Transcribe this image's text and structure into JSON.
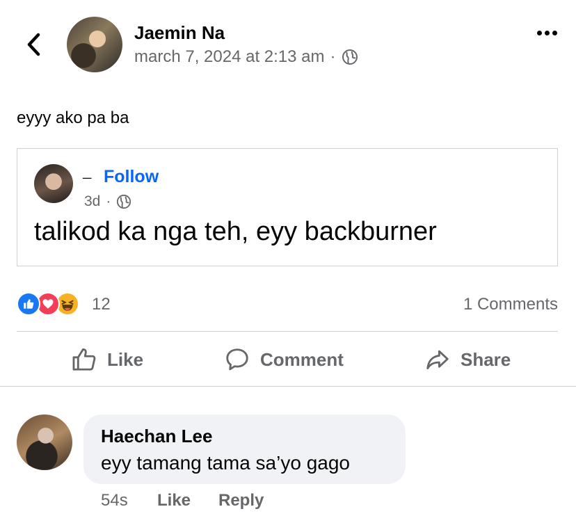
{
  "post": {
    "author": "Jaemin Na",
    "timestamp": "march 7, 2024 at 2:13 am",
    "separator": "·",
    "audience_icon": "globe-icon",
    "text": "eyyy ako pa ba"
  },
  "shared": {
    "author": "ـــ",
    "follow_label": "Follow",
    "time": "3d",
    "separator": "·",
    "audience_icon": "globe-icon",
    "text": "talikod ka nga teh, eyy backburner"
  },
  "stats": {
    "reaction_icons": [
      "like-reaction-icon",
      "love-reaction-icon",
      "haha-reaction-icon"
    ],
    "reaction_count": "12",
    "comments": "1 Comments"
  },
  "actions": {
    "like": "Like",
    "comment": "Comment",
    "share": "Share"
  },
  "comment": {
    "author": "Haechan Lee",
    "text": "eyy tamang tama sa’yo gago",
    "time": "54s",
    "like": "Like",
    "reply": "Reply"
  },
  "colors": {
    "accent": "#0866ff",
    "secondary_text": "#65676b",
    "divider": "#ced0d4",
    "bubble": "#f0f2f5"
  }
}
